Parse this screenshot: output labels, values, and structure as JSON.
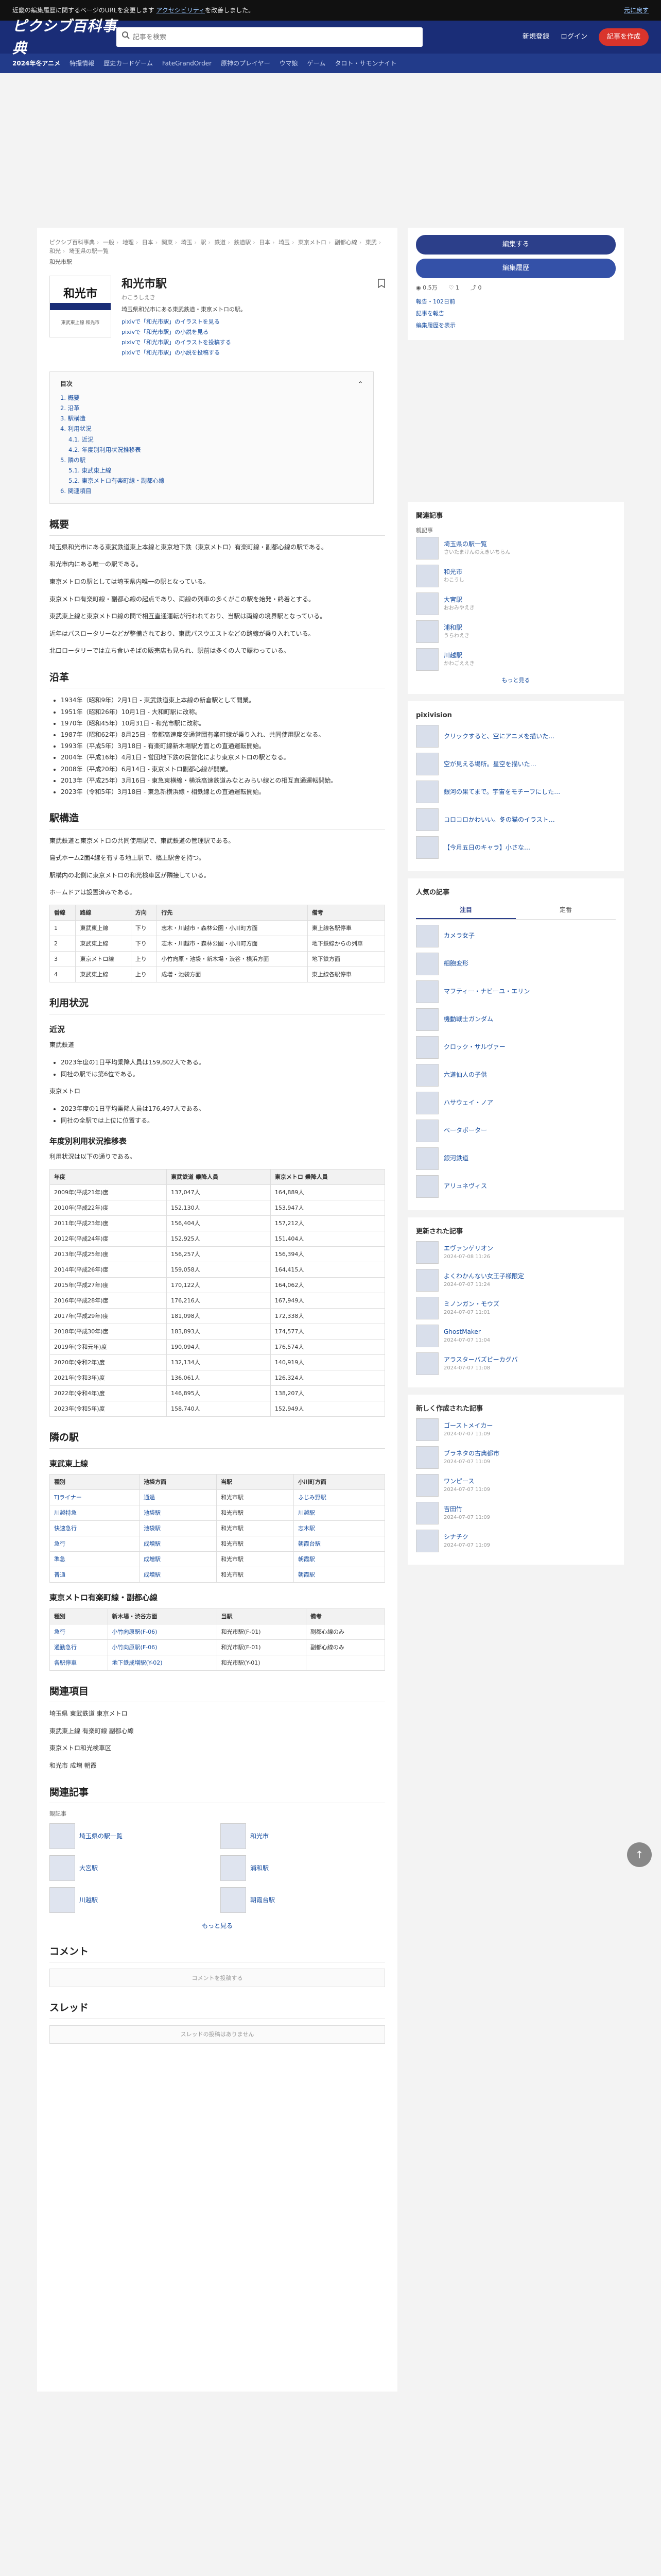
{
  "topbar": {
    "text": "近畿の編集履歴に関するページのURLを変更します",
    "link": "アクセシビリティ",
    "tail": "を改善しました。",
    "close": "元に戻す"
  },
  "header": {
    "logo": "ピクシブ百科事典",
    "search_placeholder": "記事を検索",
    "links": [
      "新規登録",
      "ログイン"
    ],
    "button": "記事を作成"
  },
  "nav": [
    "2024年冬アニメ",
    "特撮情報",
    "歴史カードゲーム",
    "FateGrandOrder",
    "原神のプレイヤー",
    "ウマ娘",
    "ゲーム",
    "タロト・サモンナイト"
  ],
  "breadcrumb": [
    "ピクシブ百科事典",
    "一般",
    "地理",
    "日本",
    "関東",
    "埼玉",
    "駅",
    "鉄道",
    "鉄道駅",
    "日本",
    "埼玉",
    "東京メトロ",
    "副都心線",
    "東武",
    "和光",
    "埼玉県の駅一覧"
  ],
  "current": "和光市駅",
  "article": {
    "thumb": {
      "top": "",
      "name": "和光市",
      "sub": "東武東上線 和光市"
    },
    "title": "和光市駅",
    "reading": "わこうしえき",
    "summary": "埼玉県和光市にある東武鉄道・東京メトロの駅。",
    "related": [
      "pixivで「和光市駅」のイラストを見る",
      "pixivで「和光市駅」の小説を見る",
      "pixivで「和光市駅」のイラストを投稿する",
      "pixivで「和光市駅」の小説を投稿する"
    ]
  },
  "toc": {
    "title": "目次",
    "items": [
      {
        "label": "1. 概要",
        "sub": false
      },
      {
        "label": "2. 沿革",
        "sub": false
      },
      {
        "label": "3. 駅構造",
        "sub": false
      },
      {
        "label": "4. 利用状況",
        "sub": false
      },
      {
        "label": "4.1. 近況",
        "sub": true
      },
      {
        "label": "4.2. 年度別利用状況推移表",
        "sub": true
      },
      {
        "label": "5. 隣の駅",
        "sub": false
      },
      {
        "label": "5.1. 東武東上線",
        "sub": true
      },
      {
        "label": "5.2. 東京メトロ有楽町線・副都心線",
        "sub": true
      },
      {
        "label": "6. 関連項目",
        "sub": false
      }
    ]
  },
  "s_overview": "概要",
  "overview": [
    "埼玉県和光市にある東武鉄道東上本線と東京地下鉄（東京メトロ）有楽町線・副都心線の駅である。",
    "和光市内にある唯一の駅である。",
    "東京メトロの駅としては埼玉県内唯一の駅となっている。",
    "東京メトロ有楽町線・副都心線の起点であり、両線の列車の多くがこの駅を始発・終着とする。",
    "東武東上線と東京メトロ線の間で相互直通運転が行われており、当駅は両線の境界駅となっている。",
    "近年はバスロータリーなどが整備されており、東武バスウエストなどの路線が乗り入れている。",
    "北口ロータリーでは立ち食いそばの販売店も見られ、駅前は多くの人で賑わっている。"
  ],
  "s_history": "沿革",
  "history": [
    "1934年（昭和9年）2月1日 - 東武鉄道東上本線の新倉駅として開業。",
    "1951年（昭和26年）10月1日 - 大和町駅に改称。",
    "1970年（昭和45年）10月31日 - 和光市駅に改称。",
    "1987年（昭和62年）8月25日 - 帝都高速度交通営団有楽町線が乗り入れ、共同使用駅となる。",
    "1993年（平成5年）3月18日 - 有楽町線新木場駅方面との直通運転開始。",
    "2004年（平成16年）4月1日 - 営団地下鉄の民営化により東京メトロの駅となる。",
    "2008年（平成20年）6月14日 - 東京メトロ副都心線が開業。",
    "2013年（平成25年）3月16日 - 東急東横線・横浜高速鉄道みなとみらい線との相互直通運転開始。",
    "2023年（令和5年）3月18日 - 東急新横浜線・相鉄線との直通運転開始。"
  ],
  "s_structure": "駅構造",
  "structure": [
    "東武鉄道と東京メトロの共同使用駅で、東武鉄道の管理駅である。",
    "島式ホーム2面4線を有する地上駅で、橋上駅舎を持つ。",
    "駅構内の北側に東京メトロの和光検車区が隣接している。",
    "ホームドアは設置済みである。"
  ],
  "platform_table": {
    "headers": [
      "番線",
      "路線",
      "方向",
      "行先",
      "備考"
    ],
    "rows": [
      [
        "1",
        "東武東上線",
        "下り",
        "志木・川越市・森林公園・小川町方面",
        "東上線各駅停車"
      ],
      [
        "2",
        "東武東上線",
        "下り",
        "志木・川越市・森林公園・小川町方面",
        "地下鉄線からの列車"
      ],
      [
        "3",
        "東京メトロ線",
        "上り",
        "小竹向原・池袋・新木場・渋谷・横浜方面",
        "地下鉄方面"
      ],
      [
        "4",
        "東武東上線",
        "上り",
        "成増・池袋方面",
        "東上線各駅停車"
      ]
    ]
  },
  "s_usage": "利用状況",
  "s_recent": "近況",
  "recent": [
    "東武鉄道",
    "2023年度の1日平均乗降人員は159,802人である。",
    "同社の駅では第6位である。",
    "東京メトロ",
    "2023年度の1日平均乗降人員は176,497人である。",
    "同社の全駅では上位に位置する。"
  ],
  "s_yearly": "年度別利用状況推移表",
  "yearly_note": "利用状況は以下の通りである。",
  "yearly_table": {
    "headers": [
      "年度",
      "東武鉄道 乗降人員",
      "東京メトロ 乗降人員"
    ],
    "rows": [
      [
        "2009年(平成21年)度",
        "137,047人",
        "164,889人"
      ],
      [
        "2010年(平成22年)度",
        "152,130人",
        "153,947人"
      ],
      [
        "2011年(平成23年)度",
        "156,404人",
        "157,212人"
      ],
      [
        "2012年(平成24年)度",
        "152,925人",
        "151,404人"
      ],
      [
        "2013年(平成25年)度",
        "156,257人",
        "156,394人"
      ],
      [
        "2014年(平成26年)度",
        "159,058人",
        "164,415人"
      ],
      [
        "2015年(平成27年)度",
        "170,122人",
        "164,062人"
      ],
      [
        "2016年(平成28年)度",
        "176,216人",
        "167,949人"
      ],
      [
        "2017年(平成29年)度",
        "181,098人",
        "172,338人"
      ],
      [
        "2018年(平成30年)度",
        "183,893人",
        "174,577人"
      ],
      [
        "2019年(令和元年)度",
        "190,094人",
        "176,574人"
      ],
      [
        "2020年(令和2年)度",
        "132,134人",
        "140,919人"
      ],
      [
        "2021年(令和3年)度",
        "136,061人",
        "126,324人"
      ],
      [
        "2022年(令和4年)度",
        "146,895人",
        "138,207人"
      ],
      [
        "2023年(令和5年)度",
        "158,740人",
        "152,949人"
      ]
    ]
  },
  "s_neighbor": "隣の駅",
  "s_tobu": "東武東上線",
  "tobu_table": {
    "headers": [
      "種別",
      "池袋方面",
      "当駅",
      "小川町方面"
    ],
    "rows": [
      [
        "TJライナー",
        "通過",
        "和光市駅",
        "ふじみ野駅"
      ],
      [
        "川越特急",
        "池袋駅",
        "和光市駅",
        "川越駅"
      ],
      [
        "快速急行",
        "池袋駅",
        "和光市駅",
        "志木駅"
      ],
      [
        "急行",
        "成増駅",
        "和光市駅",
        "朝霞台駅"
      ],
      [
        "準急",
        "成増駅",
        "和光市駅",
        "朝霞駅"
      ],
      [
        "普通",
        "成増駅",
        "和光市駅",
        "朝霞駅"
      ]
    ]
  },
  "s_metro": "東京メトロ有楽町線・副都心線",
  "metro_table": {
    "headers": [
      "種別",
      "新木場・渋谷方面",
      "当駅",
      "備考"
    ],
    "rows": [
      [
        "急行",
        "小竹向原駅(F-06)",
        "和光市駅(F-01)",
        "副都心線のみ"
      ],
      [
        "通勤急行",
        "小竹向原駅(F-06)",
        "和光市駅(F-01)",
        "副都心線のみ"
      ],
      [
        "各駅停車",
        "地下鉄成増駅(Y-02)",
        "和光市駅(Y-01)",
        ""
      ]
    ]
  },
  "s_related": "関連項目",
  "related_links": [
    "埼玉県 東武鉄道 東京メトロ",
    "東武東上線 有楽町線 副都心線",
    "東京メトロ和光検車区",
    "和光市 成増 朝霞"
  ],
  "related_articles_title": "関連記事",
  "related_articles_sub": "親記事",
  "related_articles": [
    {
      "title": "埼玉県の駅一覧"
    },
    {
      "title": "和光市"
    },
    {
      "title": "大宮駅"
    },
    {
      "title": "浦和駅"
    },
    {
      "title": "川越駅"
    },
    {
      "title": "朝霞台駅"
    }
  ],
  "more_link": "もっと見る",
  "comment_title": "コメント",
  "comment_placeholder": "コメントを投稿する",
  "thread_title": "スレッド",
  "thread_placeholder": "スレッドの投稿はありません",
  "side": {
    "edit_btn": "編集する",
    "history_btn": "編集履歴",
    "stats": [
      "0.5万",
      "1",
      "0"
    ],
    "report": "報告・102日前",
    "lines": [
      "記事を報告",
      "編集履歴を表示"
    ],
    "related_title": "関連記事",
    "related_sub1": "親記事",
    "related_items": [
      {
        "t": "埼玉県の駅一覧",
        "d": "さいたまけんのえきいちらん"
      },
      {
        "t": "和光市",
        "d": "わこうし"
      },
      {
        "t": "大宮駅",
        "d": "おおみやえき"
      },
      {
        "t": "浦和駅",
        "d": "うらわえき"
      },
      {
        "t": "川越駅",
        "d": "かわごええき"
      }
    ],
    "more": "もっと見る",
    "pixiv_title": "pixivision",
    "pixiv_items": [
      {
        "t": "クリックすると、空にアニメを描いた…"
      },
      {
        "t": "空が見える場所。星空を描いた…"
      },
      {
        "t": "銀河の果てまで。宇宙をモチーフにした…"
      },
      {
        "t": "コロコロかわいい。冬の猫のイラスト…"
      },
      {
        "t": "【今月五日のキャラ】小さな…"
      }
    ],
    "popular_title": "人気の記事",
    "tabs": [
      "注目",
      "定番"
    ],
    "popular_items": [
      {
        "t": "カメラ女子"
      },
      {
        "t": "細胞変形"
      },
      {
        "t": "マフティー・ナビーユ・エリン"
      },
      {
        "t": "機動戦士ガンダム"
      },
      {
        "t": "クロック・サルヴァー"
      },
      {
        "t": "六道仙人の子供"
      },
      {
        "t": "ハサウェイ・ノア"
      },
      {
        "t": "ベータポーター"
      },
      {
        "t": "銀河鉄道"
      },
      {
        "t": "アリュネヴィス"
      }
    ],
    "updated_title": "更新された記事",
    "updated_items": [
      {
        "t": "エヴァンゲリオン",
        "d": "2024-07-08 11:26"
      },
      {
        "t": "よくわかんない女王子様限定",
        "d": "2024-07-07 11:24"
      },
      {
        "t": "ミノンガン・モウズ",
        "d": "2024-07-07 11:01"
      },
      {
        "t": "GhostMaker",
        "d": "2024-07-07 11:04"
      },
      {
        "t": "アラスターバズビーカグバ",
        "d": "2024-07-07 11:08"
      }
    ],
    "new_title": "新しく作成された記事",
    "new_items": [
      {
        "t": "ゴーストメイカー",
        "d": "2024-07-07 11:09"
      },
      {
        "t": "ブラネタの古典都市",
        "d": "2024-07-07 11:09"
      },
      {
        "t": "ワンピース",
        "d": "2024-07-07 11:09"
      },
      {
        "t": "吉田竹",
        "d": "2024-07-07 11:09"
      },
      {
        "t": "シナチク",
        "d": "2024-07-07 11:09"
      }
    ]
  }
}
